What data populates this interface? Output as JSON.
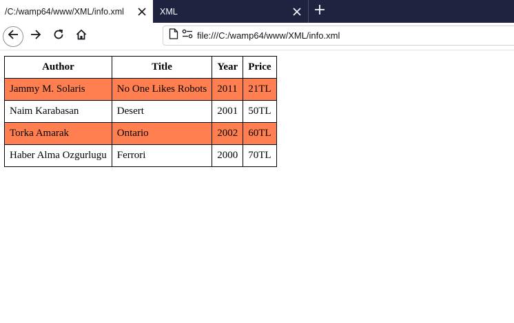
{
  "tabs": [
    {
      "title": "/C:/wamp64/www/XML/info.xml",
      "active": true
    },
    {
      "title": "XML",
      "active": false
    }
  ],
  "url": "file:///C:/wamp64/www/XML/info.xml",
  "colors": {
    "tabbar": "#1f2340",
    "highlight_row": "#ff7f50"
  },
  "icons": {
    "close": "close-icon",
    "new_tab": "plus-icon",
    "back": "back-arrow-icon",
    "forward": "forward-arrow-icon",
    "reload": "reload-icon",
    "home": "home-icon",
    "page": "page-icon",
    "permissions": "permissions-icon"
  },
  "table": {
    "headers": [
      "Author",
      "Title",
      "Year",
      "Price"
    ],
    "rows": [
      {
        "author": "Jammy M. Solaris",
        "title": "No One Likes Robots",
        "year": "2011",
        "price": "21TL",
        "highlight": true
      },
      {
        "author": "Naim Karabasan",
        "title": "Desert",
        "year": "2001",
        "price": "50TL",
        "highlight": false
      },
      {
        "author": "Torka Amarak",
        "title": "Ontario",
        "year": "2002",
        "price": "60TL",
        "highlight": true
      },
      {
        "author": "Haber Alma Ozgurlugu",
        "title": "Ferrori",
        "year": "2000",
        "price": "70TL",
        "highlight": false
      }
    ]
  }
}
